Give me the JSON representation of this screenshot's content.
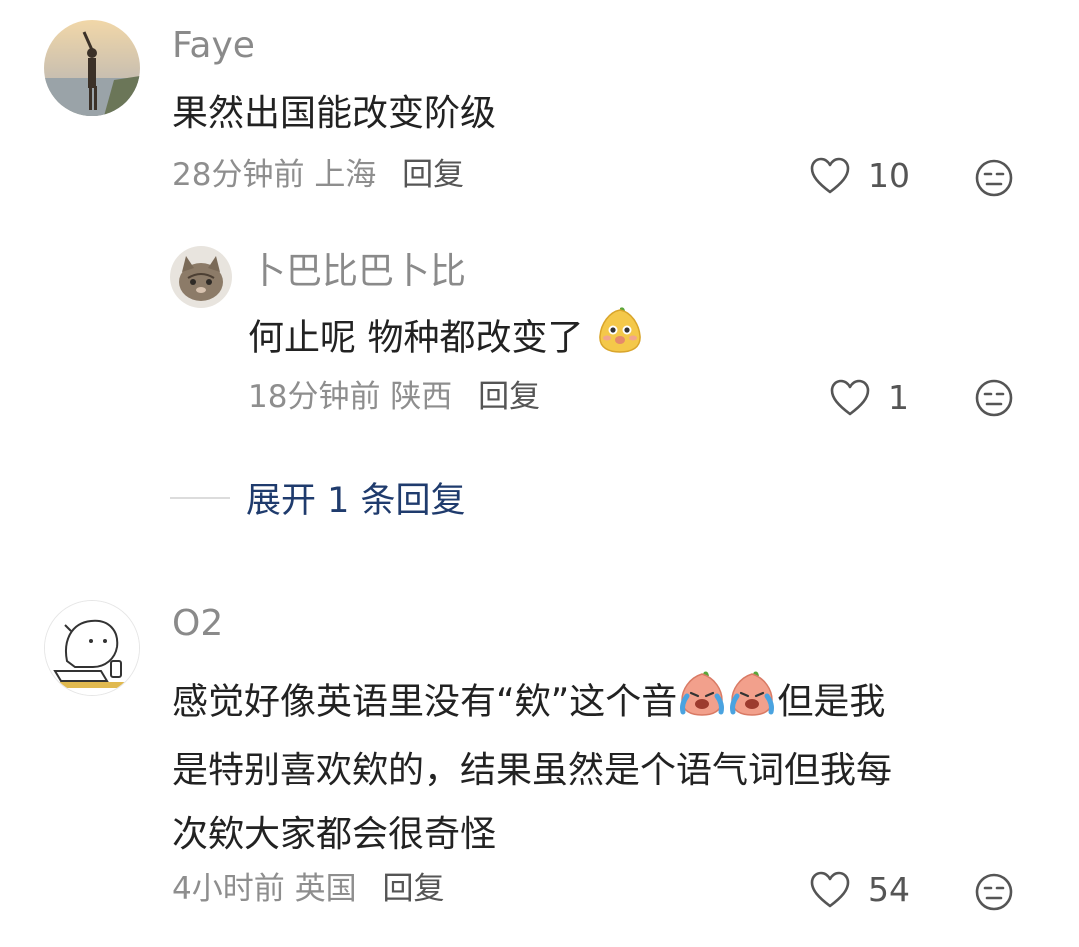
{
  "comments": [
    {
      "username": "Faye",
      "text": "果然出国能改变阶级",
      "time": "28分钟前",
      "location": "上海",
      "reply_label": "回复",
      "like_count": "10",
      "replies": [
        {
          "username": "卜巴比巴卜比",
          "text": "何止呢 物种都改变了",
          "time": "18分钟前",
          "location": "陕西",
          "reply_label": "回复",
          "like_count": "1"
        }
      ],
      "expand_label": "展开 1 条回复"
    },
    {
      "username": "O2",
      "text_lines": [
        "感觉好像英语里没有“欸”这个音",
        "但是我",
        "是特别喜欢欸的，结果虽然是个语气词但我每",
        "次欸大家都会很奇怪"
      ],
      "time": "4小时前",
      "location": "英国",
      "reply_label": "回复",
      "like_count": "54"
    }
  ],
  "icons": {
    "like": "heart-outline-icon",
    "dislike": "meh-face-icon",
    "emoji_reply": "yellow-pear-emoji",
    "emoji_crying": "crying-peach-emoji"
  },
  "colors": {
    "username": "#8a8a8a",
    "meta": "#8e8e8e",
    "expand_link": "#1f3b6d"
  }
}
